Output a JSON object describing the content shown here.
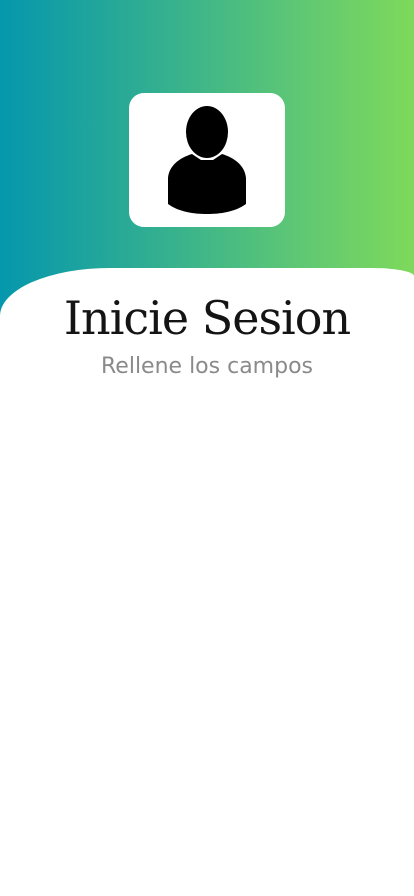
{
  "header": {
    "gradient_colors": [
      "#0597ad",
      "#2fad93",
      "#5cc676",
      "#7ed95a"
    ],
    "avatar_icon": "user-icon"
  },
  "login": {
    "title": "Inicie Sesion",
    "subtitle": "Rellene los campos",
    "title_color": "#141414",
    "subtitle_color": "#8a8a8a"
  }
}
